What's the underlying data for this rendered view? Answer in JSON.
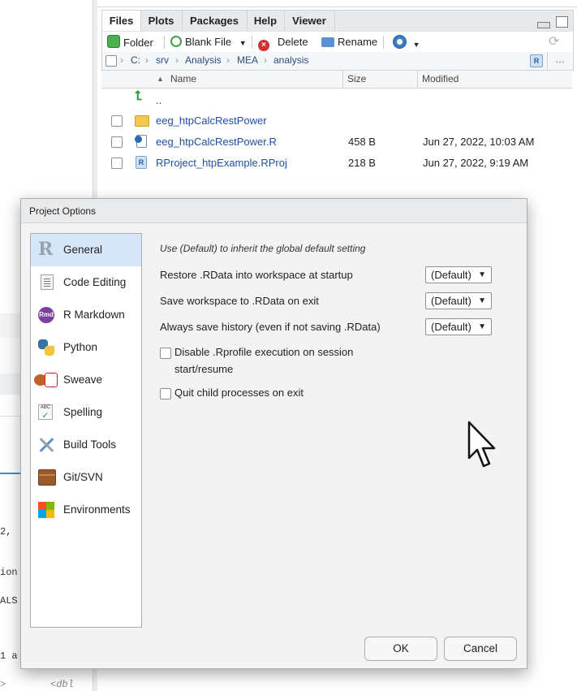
{
  "background_code": {
    "lines": [
      "2,",
      "ion",
      "ALS",
      "1 a",
      ">",
      "<dbl"
    ]
  },
  "files_pane": {
    "tabs": [
      "Files",
      "Plots",
      "Packages",
      "Help",
      "Viewer"
    ],
    "toolbar": {
      "folder_label": "Folder",
      "blank_file_label": "Blank File",
      "delete_label": "Delete",
      "rename_label": "Rename"
    },
    "breadcrumb": [
      "C:",
      "srv",
      "Analysis",
      "MEA",
      "analysis"
    ],
    "columns": {
      "name": "Name",
      "size": "Size",
      "modified": "Modified"
    },
    "parent_dir": "..",
    "files": [
      {
        "name": "eeg_htpCalcRestPower",
        "size": "",
        "modified": "",
        "type": "folder"
      },
      {
        "name": "eeg_htpCalcRestPower.R",
        "size": "458 B",
        "modified": "Jun 27, 2022, 10:03 AM",
        "type": "r-script"
      },
      {
        "name": "RProject_htpExample.RProj",
        "size": "218 B",
        "modified": "Jun 27, 2022, 9:19 AM",
        "type": "rproj"
      }
    ]
  },
  "dialog": {
    "title": "Project Options",
    "nav": [
      {
        "label": "General",
        "icon": "r-logo-icon",
        "selected": true
      },
      {
        "label": "Code Editing",
        "icon": "document-icon",
        "selected": false
      },
      {
        "label": "R Markdown",
        "icon": "rmd-icon",
        "selected": false
      },
      {
        "label": "Python",
        "icon": "python-icon",
        "selected": false
      },
      {
        "label": "Sweave",
        "icon": "sweave-icon",
        "selected": false
      },
      {
        "label": "Spelling",
        "icon": "spelling-icon",
        "selected": false
      },
      {
        "label": "Build Tools",
        "icon": "build-tools-icon",
        "selected": false
      },
      {
        "label": "Git/SVN",
        "icon": "git-box-icon",
        "selected": false
      },
      {
        "label": "Environments",
        "icon": "environments-icon",
        "selected": false
      }
    ],
    "hint": "Use (Default) to inherit the global default setting",
    "options": [
      {
        "label": "Restore .RData into workspace at startup",
        "value": "(Default)"
      },
      {
        "label": "Save workspace to .RData on exit",
        "value": "(Default)"
      },
      {
        "label": "Always save history (even if not saving .RData)",
        "value": "(Default)"
      }
    ],
    "checkboxes": [
      {
        "label": "Disable .Rprofile execution on session start/resume",
        "checked": false
      },
      {
        "label": "Quit child processes on exit",
        "checked": false
      }
    ],
    "ok_label": "OK",
    "cancel_label": "Cancel"
  },
  "colors": {
    "accent": "#1f4fa3",
    "selected_nav": "#d6e6f8"
  }
}
